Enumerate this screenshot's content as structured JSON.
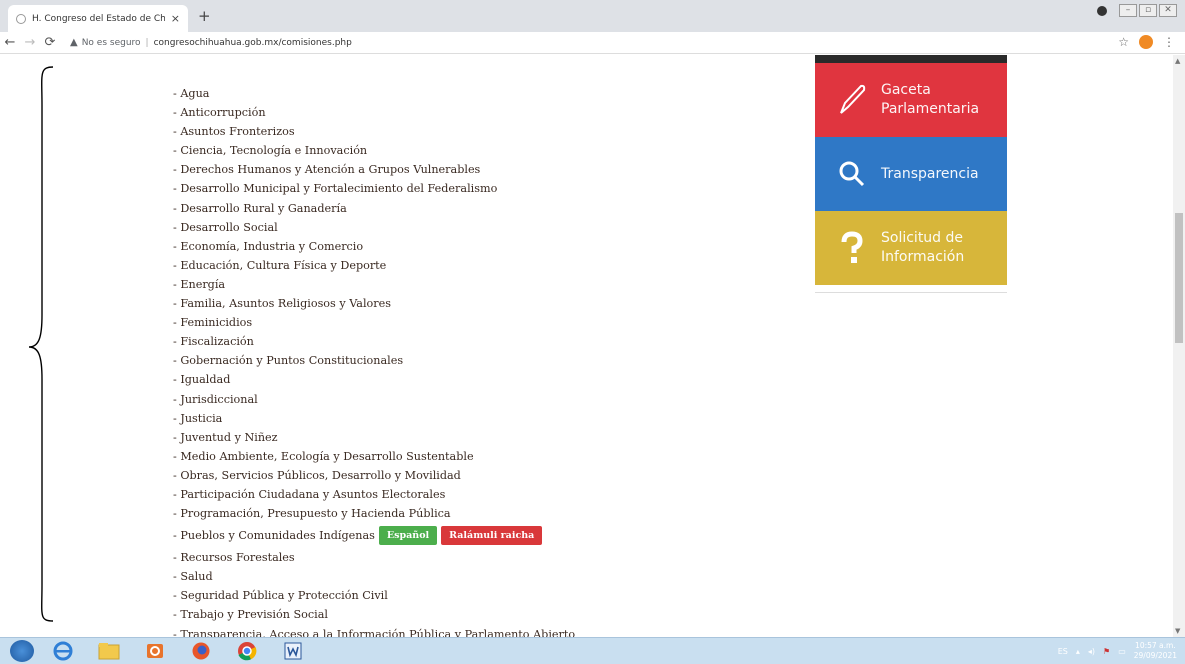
{
  "browser": {
    "tab_title": "H. Congreso del Estado de Chih.",
    "tab_close": "×",
    "new_tab": "+",
    "security_label": "No es seguro",
    "url": "congresochihuahua.gob.mx/comisiones.php"
  },
  "commissions": [
    "- Agua",
    "- Anticorrupción",
    "- Asuntos Fronterizos",
    "- Ciencia, Tecnología e Innovación",
    "- Derechos Humanos y Atención a Grupos Vulnerables",
    "- Desarrollo Municipal y Fortalecimiento del Federalismo",
    "- Desarrollo Rural y Ganadería",
    "- Desarrollo Social",
    "- Economía, Industria y Comercio",
    "- Educación, Cultura Física y Deporte",
    "- Energía",
    "- Familia, Asuntos Religiosos y Valores",
    "- Feminicidios",
    "- Fiscalización",
    "- Gobernación y Puntos Constitucionales",
    "- Igualdad",
    "- Jurisdiccional",
    "- Justicia",
    "- Juventud y Niñez",
    "- Medio Ambiente, Ecología y Desarrollo Sustentable",
    "- Obras, Servicios Públicos, Desarrollo y Movilidad",
    "- Participación Ciudadana y Asuntos Electorales",
    "- Programación, Presupuesto y Hacienda Pública"
  ],
  "indigenous": {
    "label": "- Pueblos y Comunidades Indígenas",
    "btn_es": "Español",
    "btn_rar": "Ralámuli raicha"
  },
  "commissions_after": [
    "- Recursos Forestales",
    "- Salud",
    "- Seguridad Pública y Protección Civil",
    "- Trabajo y Previsión Social",
    "- Transparencia, Acceso a la Información Pública y Parlamento Abierto"
  ],
  "sidebar": {
    "gaceta_1": "Gaceta",
    "gaceta_2": "Parlamentaria",
    "transparencia": "Transparencia",
    "solicitud_1": "Solicitud de",
    "solicitud_2": "Información"
  },
  "taskbar": {
    "lang": "ES",
    "time": "10:57 a.m.",
    "date": "29/09/2021"
  }
}
